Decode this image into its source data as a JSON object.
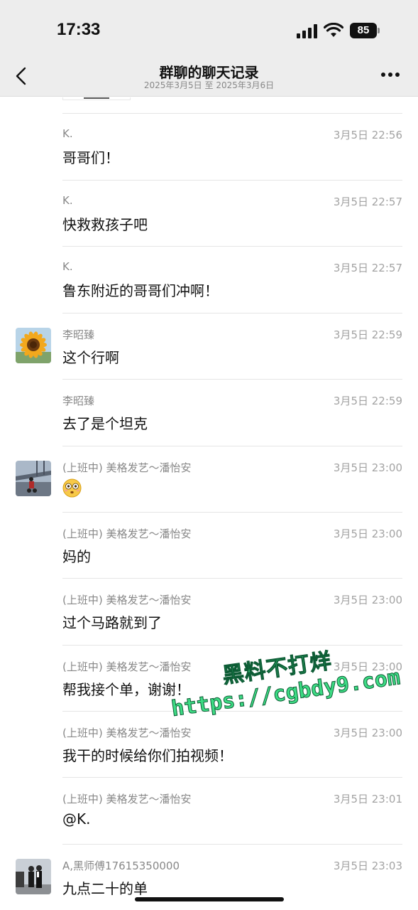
{
  "status_bar": {
    "time": "17:33",
    "battery": "85"
  },
  "nav": {
    "title": "群聊的聊天记录",
    "subtitle": "2025年3月5日 至 2025年3月6日",
    "back_icon": "chevron-left-icon",
    "more_icon": "more-dots-icon"
  },
  "messages": [
    {
      "sender": "K.",
      "time": "3月5日 22:56",
      "text": "哥哥们！",
      "avatar": null
    },
    {
      "sender": "K.",
      "time": "3月5日 22:57",
      "text": "快救救孩子吧",
      "avatar": null
    },
    {
      "sender": "K.",
      "time": "3月5日 22:57",
      "text": "鲁东附近的哥哥们冲啊！",
      "avatar": null
    },
    {
      "sender": "李昭臻",
      "time": "3月5日 22:59",
      "text": "这个行啊",
      "avatar": "sunflower-avatar"
    },
    {
      "sender": "李昭臻",
      "time": "3月5日 22:59",
      "text": "去了是个坦克",
      "avatar": null
    },
    {
      "sender": "(上班中) 美格发艺～潘怡安",
      "time": "3月5日 23:00",
      "text": "",
      "emoji": "flushed-face-emoji",
      "avatar": "motorcycle-bridge-avatar"
    },
    {
      "sender": "(上班中) 美格发艺～潘怡安",
      "time": "3月5日 23:00",
      "text": "妈的",
      "avatar": null
    },
    {
      "sender": "(上班中) 美格发艺～潘怡安",
      "time": "3月5日 23:00",
      "text": "过个马路就到了",
      "avatar": null
    },
    {
      "sender": "(上班中) 美格发艺～潘怡安",
      "time": "3月5日 23:00",
      "text": "帮我接个单，谢谢！",
      "avatar": null
    },
    {
      "sender": "(上班中) 美格发艺～潘怡安",
      "time": "3月5日 23:00",
      "text": "我干的时候给你们拍视频！",
      "avatar": null
    },
    {
      "sender": "(上班中) 美格发艺～潘怡安",
      "time": "3月5日 23:01",
      "text": "@K.",
      "avatar": null
    },
    {
      "sender": "A,黑师傅17615350000",
      "time": "3月5日 23:03",
      "text": "九点二十的单",
      "avatar": "two-people-avatar"
    }
  ],
  "watermark": {
    "line1": "黑料不打烊",
    "line2": "https://cgbdy9.com"
  },
  "colors": {
    "header_bg": "#ededed",
    "watermark_green": "#3ddc84"
  }
}
